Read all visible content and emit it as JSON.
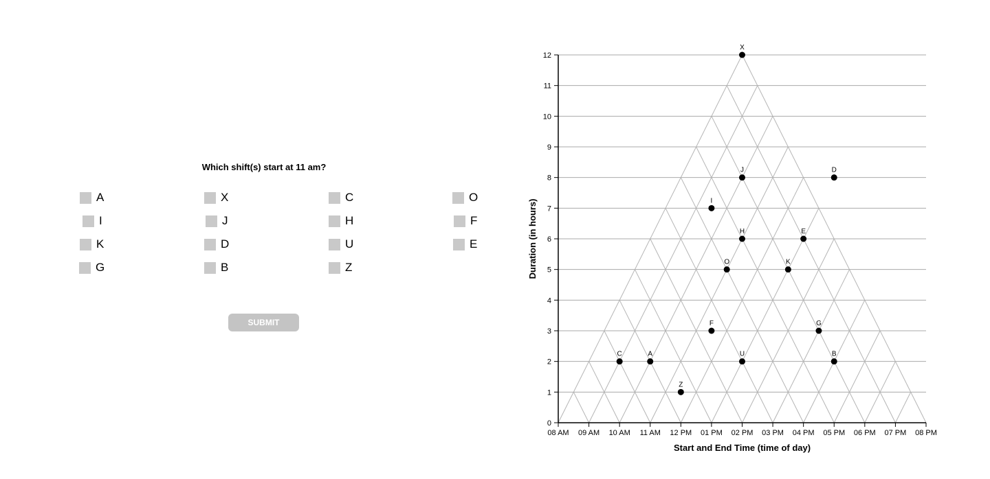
{
  "question": "Which shift(s) start at 11 am?",
  "options": [
    "A",
    "X",
    "C",
    "O",
    "I",
    "J",
    "H",
    "F",
    "K",
    "D",
    "U",
    "E",
    "G",
    "B",
    "Z"
  ],
  "submit_label": "SUBMIT",
  "chart_data": {
    "type": "scatter",
    "xlabel": "Start and End Time (time of day)",
    "ylabel": "Duration (in hours)",
    "xlim": [
      8,
      20
    ],
    "ylim": [
      0,
      12
    ],
    "x_tick_labels": [
      "08 AM",
      "09 AM",
      "10 AM",
      "11 AM",
      "12 PM",
      "01 PM",
      "02 PM",
      "03 PM",
      "04 PM",
      "05 PM",
      "06 PM",
      "07 PM",
      "08 PM"
    ],
    "y_tick_labels": [
      "0",
      "1",
      "2",
      "3",
      "4",
      "5",
      "6",
      "7",
      "8",
      "9",
      "10",
      "11",
      "12"
    ],
    "grid": "triangular",
    "points": [
      {
        "label": "X",
        "start": 8,
        "duration": 12
      },
      {
        "label": "J",
        "start": 10,
        "duration": 8
      },
      {
        "label": "D",
        "start": 13,
        "duration": 8
      },
      {
        "label": "I",
        "start": 9.5,
        "duration": 7
      },
      {
        "label": "H",
        "start": 11,
        "duration": 6
      },
      {
        "label": "E",
        "start": 13,
        "duration": 6
      },
      {
        "label": "O",
        "start": 11,
        "duration": 5
      },
      {
        "label": "K",
        "start": 13,
        "duration": 5
      },
      {
        "label": "F",
        "start": 11.5,
        "duration": 3
      },
      {
        "label": "G",
        "start": 15,
        "duration": 3
      },
      {
        "label": "C",
        "start": 9,
        "duration": 2
      },
      {
        "label": "A",
        "start": 10,
        "duration": 2
      },
      {
        "label": "U",
        "start": 13,
        "duration": 2
      },
      {
        "label": "B",
        "start": 16,
        "duration": 2
      },
      {
        "label": "Z",
        "start": 11.5,
        "duration": 1
      }
    ]
  }
}
